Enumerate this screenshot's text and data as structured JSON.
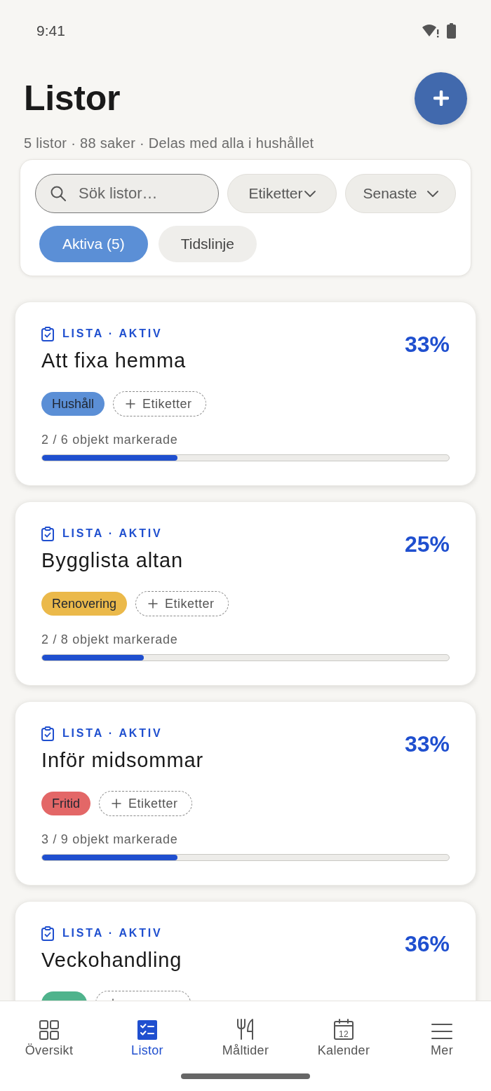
{
  "status_bar": {
    "time": "9:41"
  },
  "header": {
    "title": "Listor",
    "subtitle": "5 listor · 88 saker · Delas med alla i hushållet"
  },
  "filters": {
    "search": {
      "placeholder": "Sök listor…"
    },
    "dropdowns": [
      {
        "label": "Etiketter"
      },
      {
        "label": "Senaste"
      }
    ],
    "views": [
      {
        "label": "Aktiva (5)",
        "selected": true
      },
      {
        "label": "Tidslinje",
        "selected": false
      }
    ]
  },
  "lists": [
    {
      "label": "LISTA · AKTIV",
      "title": "Att fixa hemma",
      "percent": "33%",
      "tags": [
        {
          "label": "Hushåll",
          "color": "#5b8fd6"
        }
      ],
      "add_tag": "Etiketter",
      "count": "2 / 6 objekt markerade",
      "level": 0.333
    },
    {
      "label": "LISTA · AKTIV",
      "title": "Bygglista altan",
      "percent": "25%",
      "tags": [
        {
          "label": "Renovering",
          "color": "#ebb94a"
        }
      ],
      "add_tag": "Etiketter",
      "count": "2 / 8 objekt markerade",
      "level": 0.25
    },
    {
      "label": "LISTA · AKTIV",
      "title": "Inför midsommar",
      "percent": "33%",
      "tags": [
        {
          "label": "Fritid",
          "color": "#e36767"
        }
      ],
      "add_tag": "Etiketter",
      "count": "3 / 9 objekt markerade",
      "level": 0.333
    },
    {
      "label": "LISTA · AKTIV",
      "title": "Veckohandling",
      "percent": "36%",
      "tags": [
        {
          "color": "#4fb38c"
        }
      ],
      "add_tag_cut": true
    }
  ],
  "nav": {
    "items": [
      {
        "kind": "grid",
        "label": "Översikt",
        "selected": false
      },
      {
        "kind": "checklist",
        "label": "Listor",
        "selected": true
      },
      {
        "kind": "cutlery",
        "label": "Måltider",
        "selected": false
      },
      {
        "kind": "calendar",
        "label": "Kalender",
        "icon_text": "12",
        "selected": false
      },
      {
        "kind": "menu",
        "label": "Mer",
        "selected": false
      }
    ]
  }
}
